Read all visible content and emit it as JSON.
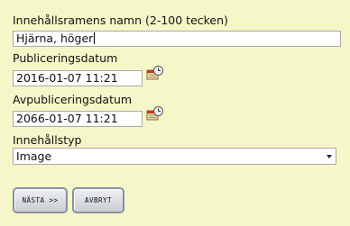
{
  "form": {
    "name_label": "Innehållsramens namn (2-100 tecken)",
    "name_value": "Hjärna, höger",
    "publish_label": "Publiceringsdatum",
    "publish_value": "2016-01-07 11:21",
    "unpublish_label": "Avpubliceringsdatum",
    "unpublish_value": "2066-01-07 11:21",
    "type_label": "Innehållstyp",
    "type_value": "Image"
  },
  "buttons": {
    "next_label": "NÄSTA >>",
    "cancel_label": "AVBRYT"
  },
  "icons": {
    "publish_calendar": "calendar-clock-icon",
    "unpublish_calendar": "calendar-clock-icon"
  }
}
